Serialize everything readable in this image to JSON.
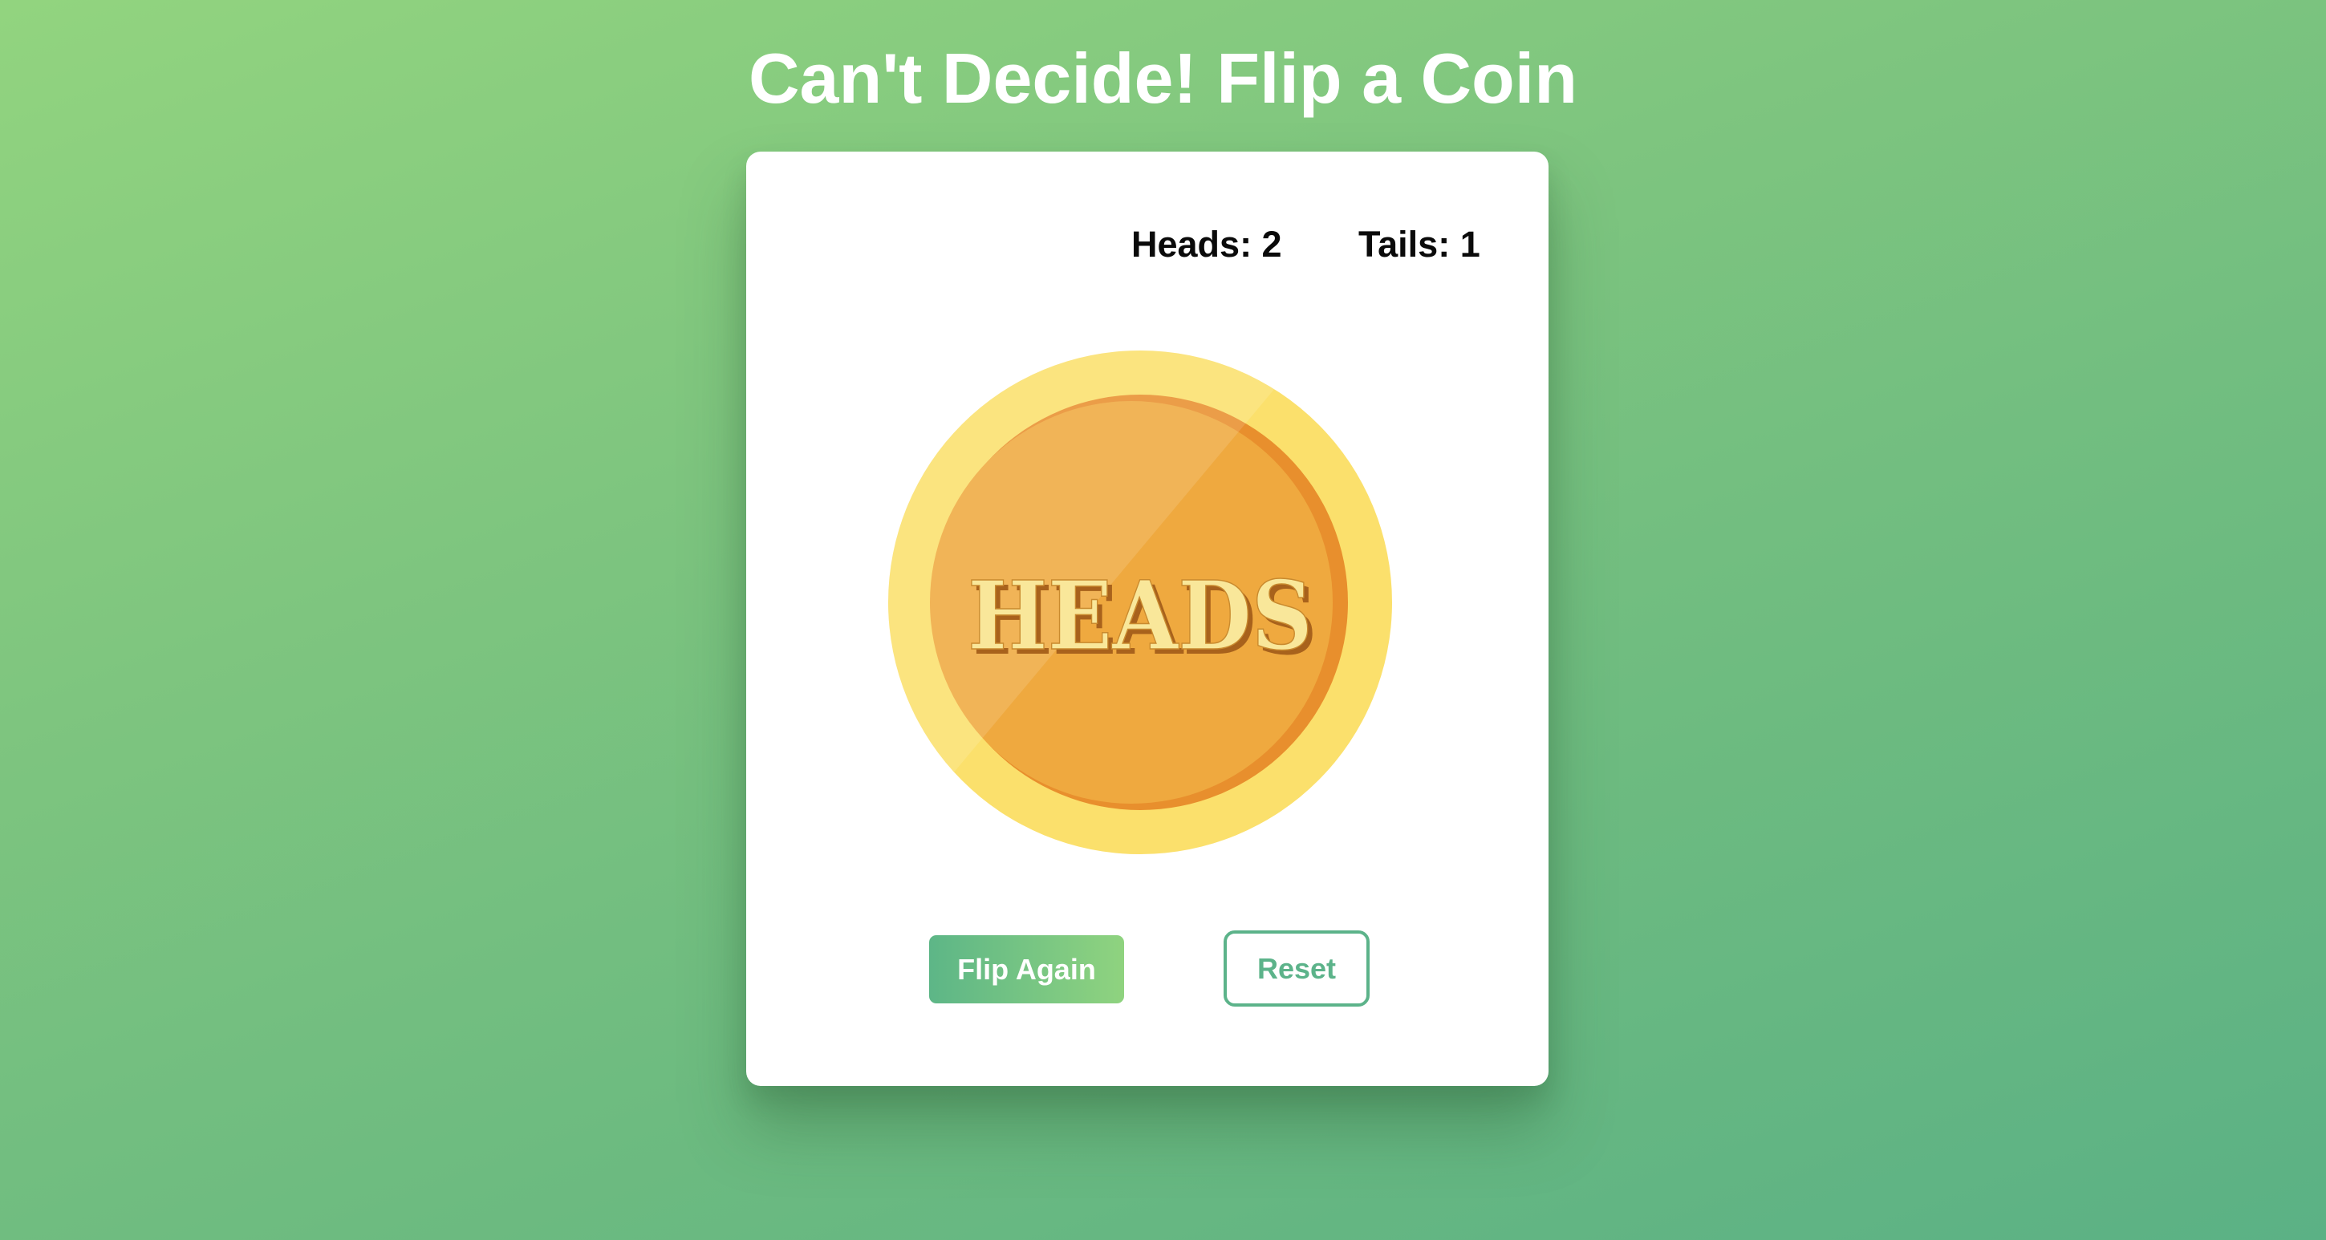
{
  "page": {
    "title": "Can't Decide! Flip a Coin"
  },
  "scoreboard": {
    "heads_label": "Heads: 2",
    "tails_label": "Tails: 1"
  },
  "coin": {
    "face_text": "HEADS",
    "icon": "coin-icon",
    "colors": {
      "rim": "#fbe06c",
      "face": "#efa93f",
      "shade": "#e88f2d",
      "text": "#f9e79a",
      "text_shadow": "#a8621c"
    }
  },
  "actions": {
    "flip_label": "Flip Again",
    "reset_label": "Reset"
  },
  "colors": {
    "background_start": "#92d47f",
    "background_end": "#5bb185",
    "accent": "#5cb38a",
    "card": "#ffffff"
  }
}
